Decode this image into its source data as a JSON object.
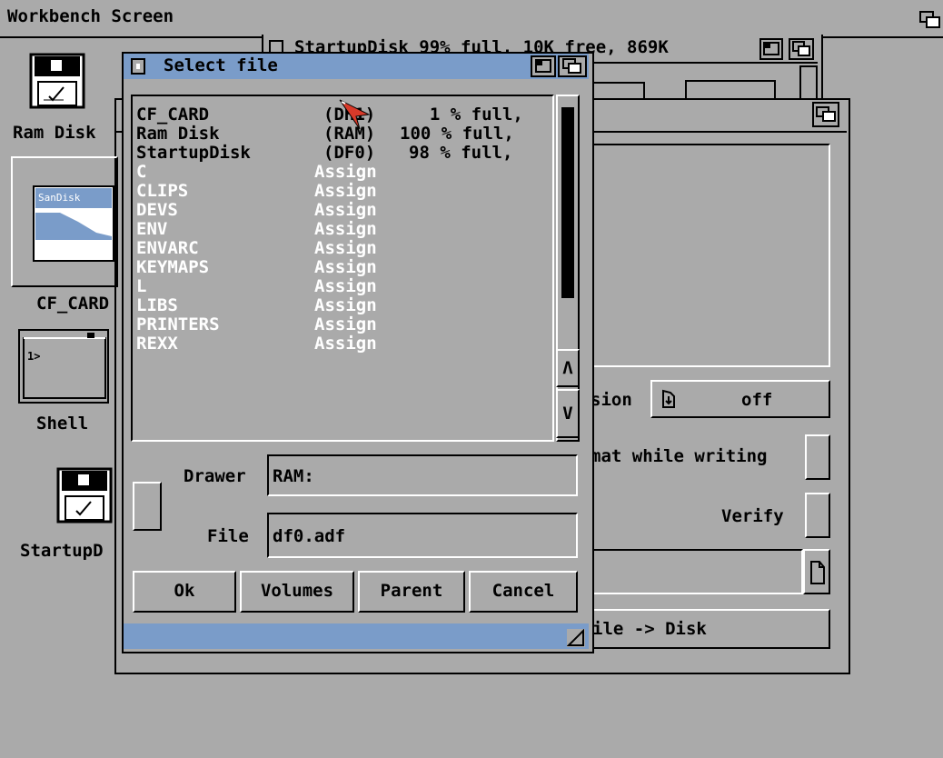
{
  "screen": {
    "title": "Workbench Screen"
  },
  "startup_window": {
    "title": "StartupDisk  99% full, 10K free, 869K"
  },
  "desktop_icons": [
    {
      "label": "Ram Disk",
      "icon": "floppy-disk-icon"
    },
    {
      "label": "CF_CARD",
      "icon": "sandisk-card-icon"
    },
    {
      "label": "Shell",
      "icon": "shell-icon"
    },
    {
      "label": "StartupD",
      "icon": "floppy-disk-icon"
    }
  ],
  "tool_window": {
    "mode_label": "sion",
    "mode_value": "off",
    "format_label": "mat while writing",
    "verify_label": "Verify",
    "action_label": "ile -> Disk"
  },
  "requester": {
    "title": "Select file",
    "entries": [
      {
        "name": "CF_CARD",
        "type": "(DH1)",
        "info": "1 % full,",
        "kind": "volume"
      },
      {
        "name": "Ram Disk",
        "type": "(RAM)",
        "info": "100 % full,",
        "kind": "volume"
      },
      {
        "name": "StartupDisk",
        "type": "(DF0)",
        "info": "98 % full,",
        "kind": "volume"
      },
      {
        "name": "C",
        "type": "Assign",
        "info": "",
        "kind": "assign"
      },
      {
        "name": "CLIPS",
        "type": "Assign",
        "info": "",
        "kind": "assign"
      },
      {
        "name": "DEVS",
        "type": "Assign",
        "info": "",
        "kind": "assign"
      },
      {
        "name": "ENV",
        "type": "Assign",
        "info": "",
        "kind": "assign"
      },
      {
        "name": "ENVARC",
        "type": "Assign",
        "info": "",
        "kind": "assign"
      },
      {
        "name": "KEYMAPS",
        "type": "Assign",
        "info": "",
        "kind": "assign"
      },
      {
        "name": "L",
        "type": "Assign",
        "info": "",
        "kind": "assign"
      },
      {
        "name": "LIBS",
        "type": "Assign",
        "info": "",
        "kind": "assign"
      },
      {
        "name": "PRINTERS",
        "type": "Assign",
        "info": "",
        "kind": "assign"
      },
      {
        "name": "REXX",
        "type": "Assign",
        "info": "",
        "kind": "assign"
      }
    ],
    "drawer_label": "Drawer",
    "drawer_value": "RAM:",
    "file_label": "File",
    "file_value": "df0.adf",
    "buttons": {
      "ok": "Ok",
      "volumes": "Volumes",
      "parent": "Parent",
      "cancel": "Cancel"
    },
    "scroll_up": "Λ",
    "scroll_down": "V"
  },
  "colors": {
    "background": "#aaaaaa",
    "title_fill": "#7a9cc9",
    "pointer": "#d83a2a",
    "text": "#000000",
    "highlight": "#ffffff"
  }
}
